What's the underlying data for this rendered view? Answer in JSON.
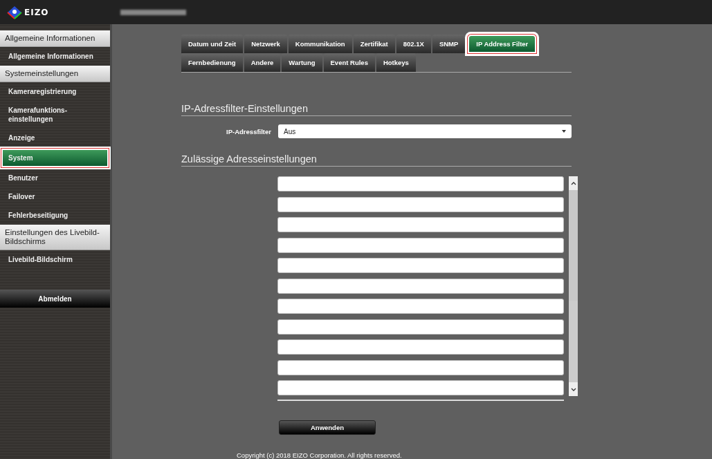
{
  "header": {
    "logo": "EIZO"
  },
  "sidebar": {
    "sections": [
      {
        "title": "Allgemeine Informationen",
        "items": [
          {
            "label": "Allgemeine Informationen",
            "selected": false
          }
        ]
      },
      {
        "title": "Systemeinstellungen",
        "items": [
          {
            "label": "Kameraregistrierung",
            "selected": false
          },
          {
            "label": "Kamerafunktions-\neinstellungen",
            "selected": false
          },
          {
            "label": "Anzeige",
            "selected": false
          },
          {
            "label": "System",
            "selected": true
          },
          {
            "label": "Benutzer",
            "selected": false
          },
          {
            "label": "Failover",
            "selected": false
          },
          {
            "label": "Fehlerbeseitigung",
            "selected": false
          }
        ]
      },
      {
        "title": "Einstellungen des Livebild-\nBildschirms",
        "items": [
          {
            "label": "Livebild-Bildschirm",
            "selected": false
          }
        ]
      }
    ],
    "logout": "Abmelden"
  },
  "tabs": [
    [
      {
        "label": "Datum und Zeit",
        "selected": false
      },
      {
        "label": "Netzwerk",
        "selected": false
      },
      {
        "label": "Kommunikation",
        "selected": false
      },
      {
        "label": "Zertifikat",
        "selected": false
      },
      {
        "label": "802.1X",
        "selected": false
      },
      {
        "label": "SNMP",
        "selected": false
      },
      {
        "label": "IP Address Filter",
        "selected": true
      }
    ],
    [
      {
        "label": "Fernbedienung",
        "selected": false
      },
      {
        "label": "Andere",
        "selected": false
      },
      {
        "label": "Wartung",
        "selected": false
      },
      {
        "label": "Event Rules",
        "selected": false
      },
      {
        "label": "Hotkeys",
        "selected": false
      }
    ]
  ],
  "filter_section": {
    "title": "IP-Adressfilter-Einstellungen",
    "label": "IP-Adressfilter",
    "value": "Aus"
  },
  "address_section": {
    "title": "Zulässige Adresseinstellungen",
    "fields": [
      {
        "kind": "text"
      },
      {
        "kind": "text"
      },
      {
        "kind": "text"
      },
      {
        "kind": "text"
      },
      {
        "kind": "text"
      },
      {
        "kind": "text"
      },
      {
        "kind": "text"
      },
      {
        "kind": "text"
      },
      {
        "kind": "text"
      },
      {
        "kind": "text"
      },
      {
        "kind": "text"
      }
    ]
  },
  "apply_button": "Anwenden",
  "copyright": "Copyright (c) 2018 EIZO Corporation. All rights reserved."
}
